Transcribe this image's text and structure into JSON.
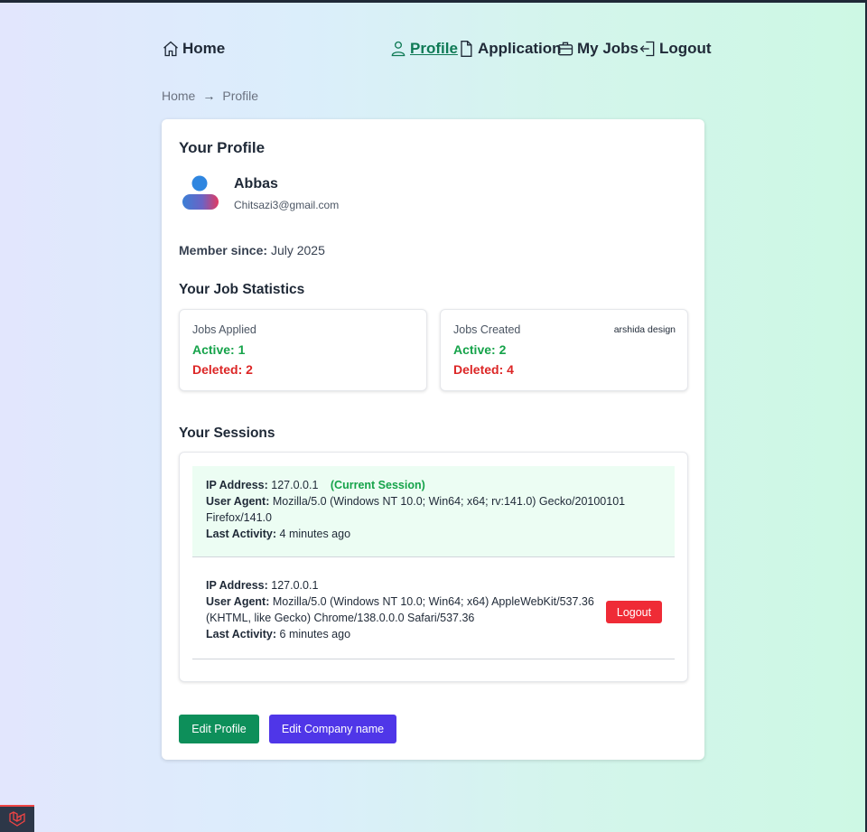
{
  "nav": {
    "home": "Home",
    "profile": "Profile",
    "application": "Application",
    "my_jobs": "My Jobs",
    "logout": "Logout"
  },
  "breadcrumb": {
    "home": "Home",
    "arrow": "→",
    "current": "Profile"
  },
  "profile": {
    "title": "Your Profile",
    "name": "Abbas",
    "email": "Chitsazi3@gmail.com",
    "member_label": "Member since:",
    "member_value": "July 2025"
  },
  "stats": {
    "title": "Your Job Statistics",
    "applied": {
      "label": "Jobs Applied",
      "active": "Active: 1",
      "deleted": "Deleted: 2"
    },
    "created": {
      "label": "Jobs Created",
      "tag": "arshida design",
      "active": "Active: 2",
      "deleted": "Deleted: 4"
    }
  },
  "sessions": {
    "title": "Your Sessions",
    "ip_label": "IP Address:",
    "ua_label": "User Agent:",
    "last_label": "Last Activity:",
    "current_tag": "(Current Session)",
    "items": [
      {
        "ip": "127.0.0.1",
        "ua": "Mozilla/5.0 (Windows NT 10.0; Win64; x64; rv:141.0) Gecko/20100101 Firefox/141.0",
        "last": "4 minutes ago"
      },
      {
        "ip": "127.0.0.1",
        "ua": "Mozilla/5.0 (Windows NT 10.0; Win64; x64) AppleWebKit/537.36 (KHTML, like Gecko) Chrome/138.0.0.0 Safari/537.36",
        "last": "6 minutes ago",
        "action": "Logout"
      }
    ]
  },
  "actions": {
    "edit_profile": "Edit Profile",
    "edit_company": "Edit Company name"
  },
  "colors": {
    "primary_green": "#0d8f5a",
    "active_green": "#16a34a",
    "danger_red": "#dc2626",
    "indigo": "#4f36e8"
  }
}
